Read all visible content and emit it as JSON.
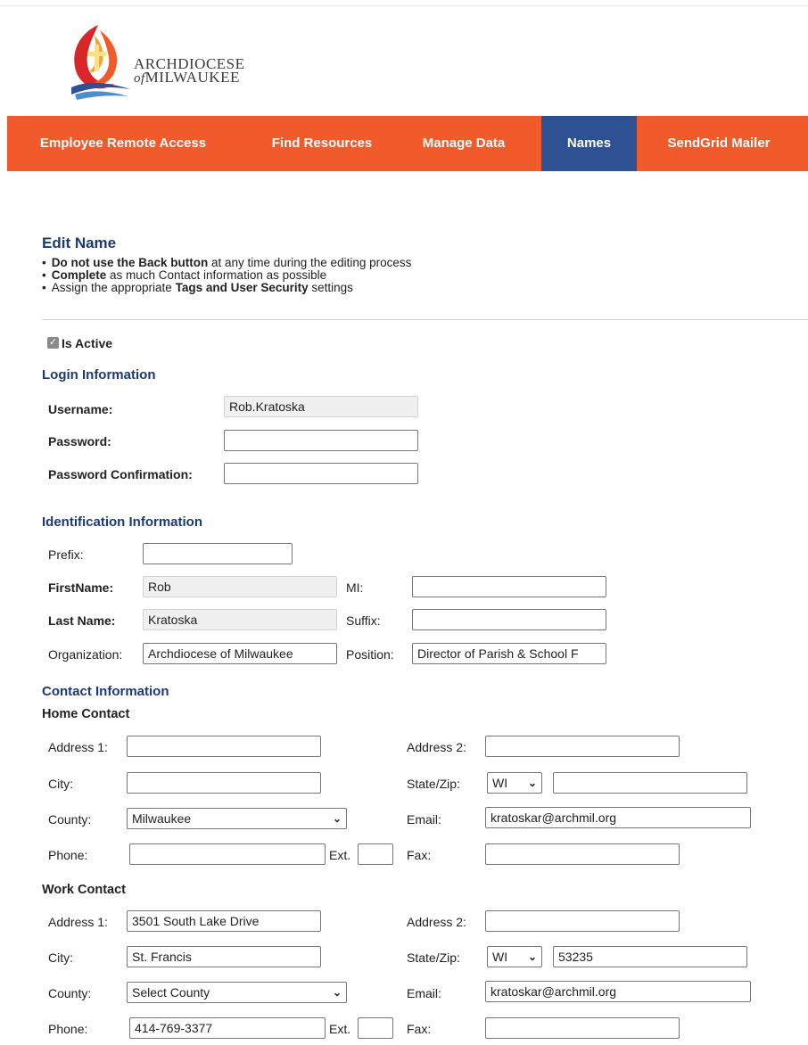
{
  "brand": {
    "line1": "ARCHDIOCESE",
    "line2_prefix": "of",
    "line2": "MILWAUKEE",
    "colors": {
      "orange": "#f15a2b",
      "red": "#d9262a",
      "blue": "#2d5192",
      "gold": "#f6a42c"
    }
  },
  "nav": {
    "items": [
      {
        "label": "Employee Remote Access"
      },
      {
        "label": "Find Resources"
      },
      {
        "label": "Manage Data"
      },
      {
        "label": "Names",
        "active": true
      },
      {
        "label": "SendGrid Mailer"
      }
    ]
  },
  "page": {
    "title": "Edit Name",
    "notes": [
      {
        "bold": "Do not use the Back button",
        "text": " at any time during the editing process"
      },
      {
        "bold": "Complete",
        "text": " as much Contact information as possible"
      },
      {
        "pre": "Assign the appropriate ",
        "bold": "Tags and User Security",
        "text": " settings"
      }
    ],
    "is_active_label": "Is Active",
    "is_active_checked": true
  },
  "login": {
    "title": "Login Information",
    "username_label": "Username:",
    "username_value": "Rob.Kratoska",
    "password_label": "Password:",
    "password_value": "",
    "confirm_label": "Password Confirmation:",
    "confirm_value": ""
  },
  "ident": {
    "title": "Identification Information",
    "prefix_label": "Prefix:",
    "prefix_value": "",
    "firstname_label": "FirstName:",
    "firstname_value": "Rob",
    "mi_label": "MI:",
    "mi_value": "",
    "lastname_label": "Last Name:",
    "lastname_value": "Kratoska",
    "suffix_label": "Suffix:",
    "suffix_value": "",
    "org_label": "Organization:",
    "org_value": "Archdiocese of Milwaukee",
    "position_label": "Position:",
    "position_value": "Director of Parish & School F"
  },
  "contact": {
    "title": "Contact Information",
    "home": {
      "title": "Home Contact",
      "address1_label": "Address 1:",
      "address1_value": "",
      "address2_label": "Address 2:",
      "address2_value": "",
      "city_label": "City:",
      "city_value": "",
      "statezip_label": "State/Zip:",
      "state_value": "WI",
      "zip_value": "",
      "county_label": "County:",
      "county_value": "Milwaukee",
      "email_label": "Email:",
      "email_value": "kratoskar@archmil.org",
      "phone_label": "Phone:",
      "phone_value": "",
      "ext_label": "Ext.",
      "ext_value": "",
      "fax_label": "Fax:",
      "fax_value": ""
    },
    "work": {
      "title": "Work Contact",
      "address1_label": "Address 1:",
      "address1_value": "3501 South Lake Drive",
      "address2_label": "Address 2:",
      "address2_value": "",
      "city_label": "City:",
      "city_value": "St. Francis",
      "statezip_label": "State/Zip:",
      "state_value": "WI",
      "zip_value": "53235",
      "county_label": "County:",
      "county_value": "Select County",
      "email_label": "Email:",
      "email_value": "kratoskar@archmil.org",
      "phone_label": "Phone:",
      "phone_value": "414-769-3377",
      "ext_label": "Ext.",
      "ext_value": "",
      "fax_label": "Fax:",
      "fax_value": ""
    }
  }
}
